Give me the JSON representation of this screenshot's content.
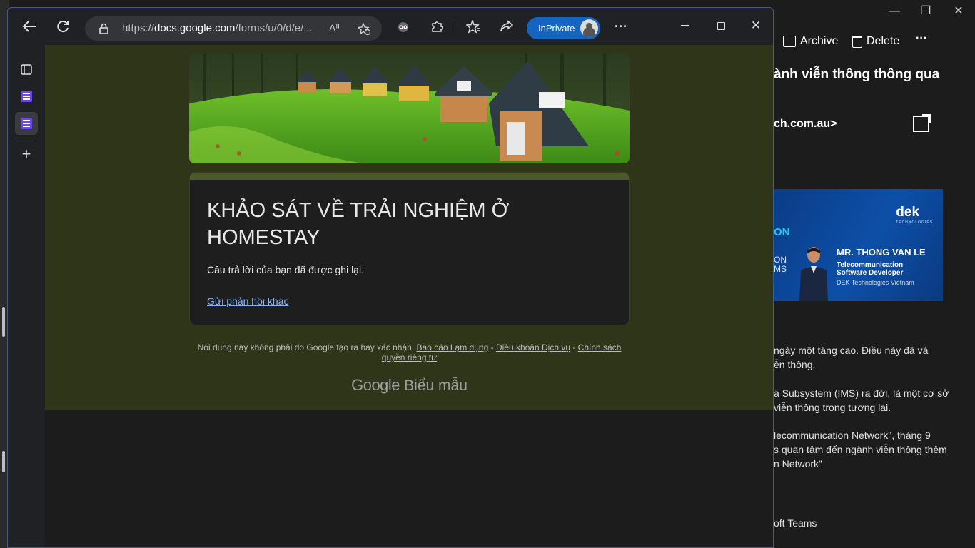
{
  "browser": {
    "url_prefix": "https://",
    "url_domain": "docs.google.com",
    "url_path": "/forms/u/0/d/e/...",
    "inprivate_label": "InPrivate"
  },
  "form": {
    "title": "KHẢO SÁT VỀ TRẢI NGHIỆM Ở HOMESTAY",
    "confirmation": "Câu trả lời của bạn đã được ghi lại.",
    "another_response_link": "Gửi phản hồi khác",
    "footer_text": "Nội dung này không phải do Google tạo ra hay xác nhận.",
    "footer_report": "Báo cáo Lạm dụng",
    "footer_sep": " - ",
    "footer_terms": "Điều khoản Dịch vụ",
    "footer_privacy": "Chính sách quyền riêng tư",
    "logo_google": "Google",
    "logo_product": "Biểu mẫu"
  },
  "mail": {
    "archive_label": "Archive",
    "delete_label": "Delete",
    "more_label": "···",
    "subject_fragment": "ành viễn thông thông qua",
    "sender_fragment": "ch.com.au>",
    "banner": {
      "logo": "dek",
      "logo_sub": "TECHNOLOGIES",
      "on1": "ON",
      "on2": "ON\nMS",
      "name": "MR. THONG VAN LE",
      "role": "Telecommunication\nSoftware Developer",
      "org": "DEK Technologies Vietnam"
    },
    "body_lines": [
      "ngày một tăng cao. Điều này đã và",
      "ễn thông.",
      "a Subsystem (IMS) ra đời, là một cơ sở",
      "viễn thông trong tương lai.",
      "lecommunication Network\", tháng 9",
      "s quan tâm đến ngành viễn thông thêm",
      "n Network”",
      "oft Teams"
    ]
  },
  "colors": {
    "page_theme": "#2f3519",
    "accent_strip": "#4d5a25",
    "link": "#8ab4f8",
    "inprivate": "#1565c0",
    "forms_icon": "#7048e8"
  }
}
